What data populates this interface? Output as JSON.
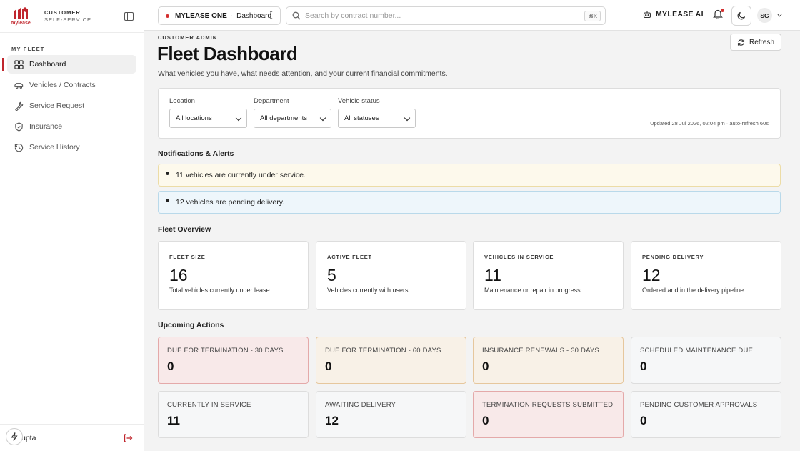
{
  "brand": {
    "logo_text": "mylease",
    "line1": "CUSTOMER",
    "line2": "SELF-SERVICE",
    "accent": "#c0262d"
  },
  "sidebar": {
    "section": "MY FLEET",
    "items": [
      {
        "label": "Dashboard",
        "icon": "dashboard-grid-icon",
        "active": true
      },
      {
        "label": "Vehicles / Contracts",
        "icon": "car-icon"
      },
      {
        "label": "Service Request",
        "icon": "wrench-icon"
      },
      {
        "label": "Insurance",
        "icon": "shield-icon"
      },
      {
        "label": "Service History",
        "icon": "history-icon"
      }
    ],
    "user_name": "S. Gupta"
  },
  "topbar": {
    "app_name": "MYLEASE ONE",
    "app_page": "Dashboard",
    "search_placeholder": "Search by contract number...",
    "search_shortcut": "⌘K",
    "ai_label": "MYLEASE AI",
    "avatar_initials": "SG"
  },
  "header": {
    "eyebrow": "CUSTOMER ADMIN",
    "title": "Fleet Dashboard",
    "subtitle": "What vehicles you have, what needs attention, and your current financial commitments.",
    "refresh_label": "Refresh"
  },
  "filters": {
    "location_label": "Location",
    "location_value": "All locations",
    "department_label": "Department",
    "department_value": "All departments",
    "status_label": "Vehicle status",
    "status_value": "All statuses",
    "updated_text": "Updated 28 Jul 2026, 02:04 pm · auto-refresh 60s"
  },
  "alerts": {
    "heading": "Notifications & Alerts",
    "items": [
      {
        "text": "11 vehicles are currently under service.",
        "level": "warning"
      },
      {
        "text": "12 vehicles are pending delivery.",
        "level": "info"
      }
    ]
  },
  "overview": {
    "heading": "Fleet Overview",
    "cards": [
      {
        "label": "FLEET SIZE",
        "value": "16",
        "desc": "Total vehicles currently under lease"
      },
      {
        "label": "ACTIVE FLEET",
        "value": "5",
        "desc": "Vehicles currently with users"
      },
      {
        "label": "VEHICLES IN SERVICE",
        "value": "11",
        "desc": "Maintenance or repair in progress"
      },
      {
        "label": "PENDING DELIVERY",
        "value": "12",
        "desc": "Ordered and in the delivery pipeline"
      }
    ]
  },
  "actions": {
    "heading": "Upcoming Actions",
    "cards": [
      {
        "label": "DUE FOR TERMINATION - 30 DAYS",
        "value": "0",
        "tone": "red"
      },
      {
        "label": "DUE FOR TERMINATION - 60 DAYS",
        "value": "0",
        "tone": "amber"
      },
      {
        "label": "INSURANCE RENEWALS - 30 DAYS",
        "value": "0",
        "tone": "amber"
      },
      {
        "label": "SCHEDULED MAINTENANCE DUE",
        "value": "0",
        "tone": "neutral"
      },
      {
        "label": "CURRENTLY IN SERVICE",
        "value": "11",
        "tone": "neutral"
      },
      {
        "label": "AWAITING DELIVERY",
        "value": "12",
        "tone": "neutral"
      },
      {
        "label": "TERMINATION REQUESTS SUBMITTED",
        "value": "0",
        "tone": "red"
      },
      {
        "label": "PENDING CUSTOMER APPROVALS",
        "value": "0",
        "tone": "neutral"
      }
    ]
  }
}
